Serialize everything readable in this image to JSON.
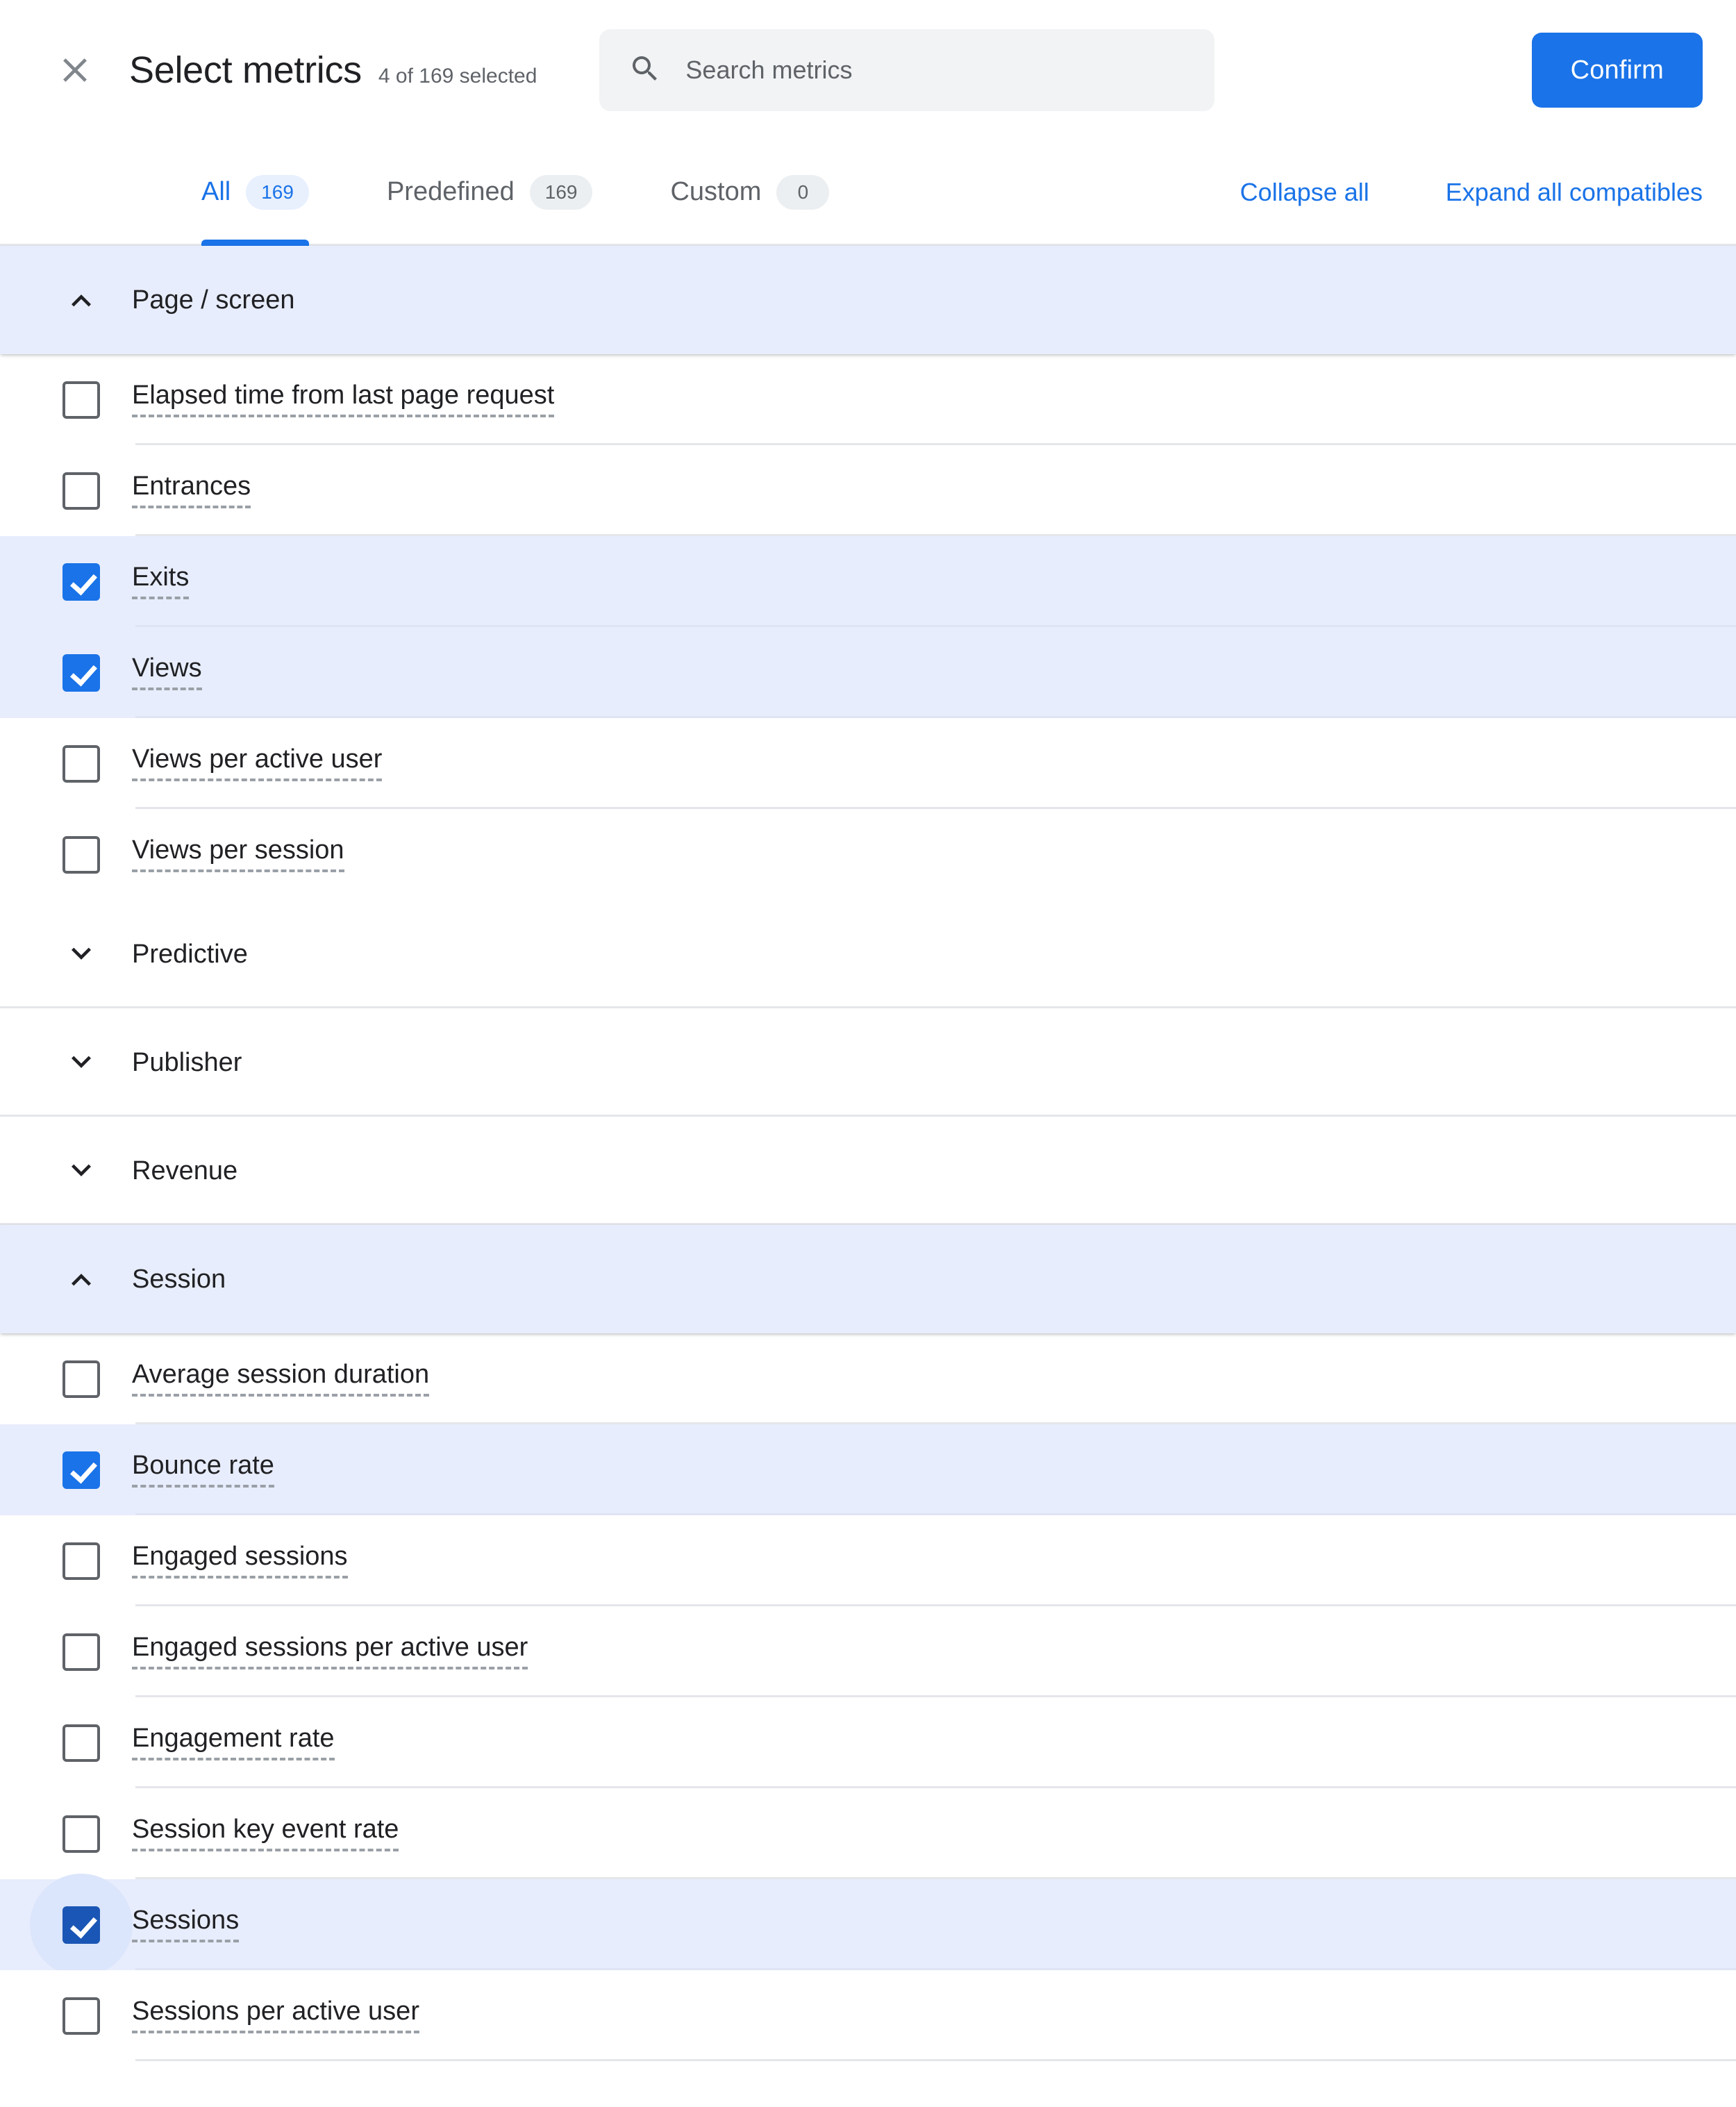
{
  "header": {
    "close_icon": "close-icon",
    "title": "Select metrics",
    "selected_summary": "4 of 169 selected",
    "search": {
      "icon": "search-icon",
      "value": "",
      "placeholder": "Search metrics"
    },
    "confirm_label": "Confirm"
  },
  "tabs": [
    {
      "label": "All",
      "count": "169",
      "active": true
    },
    {
      "label": "Predefined",
      "count": "169",
      "active": false
    },
    {
      "label": "Custom",
      "count": "0",
      "active": false
    }
  ],
  "tab_actions": [
    {
      "label": "Collapse all"
    },
    {
      "label": "Expand all compatibles"
    }
  ],
  "colors": {
    "accent": "#1a73e8",
    "selected_row_bg": "#e8edfd",
    "group_header_bg": "#e8edfd",
    "divider": "#e4e6ea",
    "text_primary": "#202124",
    "text_secondary": "#5f6368",
    "checkbox_border": "#5f6368",
    "checkbox_pressed": "#1a56b5",
    "ripple": "#dbe5fb"
  },
  "groups": [
    {
      "name": "Page / screen",
      "expanded": true,
      "chevron_icon": "chevron-up-icon",
      "items": [
        {
          "label": "Elapsed time from last page request",
          "checked": false
        },
        {
          "label": "Entrances",
          "checked": false
        },
        {
          "label": "Exits",
          "checked": true
        },
        {
          "label": "Views",
          "checked": true
        },
        {
          "label": "Views per active user",
          "checked": false
        },
        {
          "label": "Views per session",
          "checked": false
        }
      ]
    },
    {
      "name": "Predictive",
      "expanded": false,
      "chevron_icon": "chevron-down-icon",
      "items": []
    },
    {
      "name": "Publisher",
      "expanded": false,
      "chevron_icon": "chevron-down-icon",
      "items": []
    },
    {
      "name": "Revenue",
      "expanded": false,
      "chevron_icon": "chevron-down-icon",
      "items": []
    },
    {
      "name": "Session",
      "expanded": true,
      "chevron_icon": "chevron-up-icon",
      "items": [
        {
          "label": "Average session duration",
          "checked": false
        },
        {
          "label": "Bounce rate",
          "checked": true
        },
        {
          "label": "Engaged sessions",
          "checked": false
        },
        {
          "label": "Engaged sessions per active user",
          "checked": false
        },
        {
          "label": "Engagement rate",
          "checked": false
        },
        {
          "label": "Session key event rate",
          "checked": false
        },
        {
          "label": "Sessions",
          "checked": true,
          "pressed": true
        },
        {
          "label": "Sessions per active user",
          "checked": false
        }
      ]
    }
  ]
}
